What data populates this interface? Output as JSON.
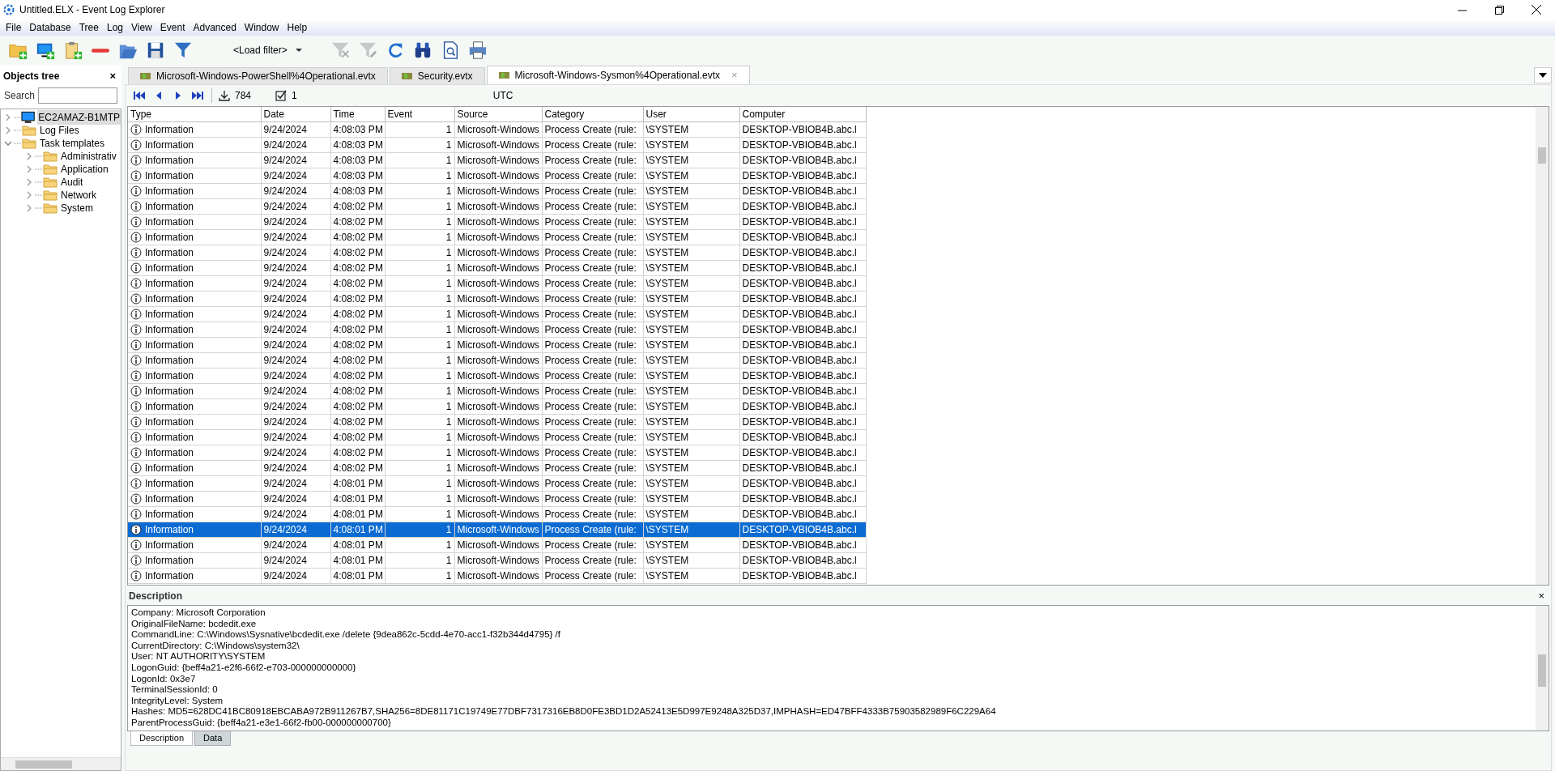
{
  "window": {
    "title": "Untitled.ELX - Event Log Explorer"
  },
  "menu": [
    "File",
    "Database",
    "Tree",
    "Log",
    "View",
    "Event",
    "Advanced",
    "Window",
    "Help"
  ],
  "toolbar": {
    "left": [
      {
        "kind": "new-folder",
        "disabled": false
      },
      {
        "kind": "computer-add",
        "disabled": false
      },
      {
        "kind": "clipboard-add",
        "disabled": false
      },
      {
        "kind": "remove",
        "disabled": false
      },
      {
        "kind": "open",
        "disabled": false
      },
      {
        "kind": "save",
        "disabled": false
      },
      {
        "kind": "filter",
        "disabled": false
      }
    ],
    "filter_combo": {
      "value": "<Load filter>"
    },
    "right": [
      {
        "kind": "filter-clear",
        "disabled": true
      },
      {
        "kind": "filter-edit",
        "disabled": true
      },
      {
        "kind": "refresh",
        "disabled": false
      },
      {
        "kind": "find",
        "disabled": false
      },
      {
        "kind": "preview",
        "disabled": false
      },
      {
        "kind": "print",
        "disabled": false
      }
    ]
  },
  "objects_tree": {
    "title": "Objects tree",
    "close": "×",
    "search_label": "Search",
    "items": [
      {
        "label": "EC2AMAZ-B1MTP",
        "kind": "computer",
        "expanded": false,
        "selected": true
      },
      {
        "label": "Log Files",
        "kind": "folder",
        "expanded": false,
        "selected": false
      },
      {
        "label": "Task templates",
        "kind": "folder",
        "expanded": true,
        "selected": false,
        "children": [
          {
            "label": "Administrativ",
            "kind": "folder",
            "expanded": false,
            "selected": false
          },
          {
            "label": "Application",
            "kind": "folder",
            "expanded": false,
            "selected": false
          },
          {
            "label": "Audit",
            "kind": "folder",
            "expanded": false,
            "selected": false
          },
          {
            "label": "Network",
            "kind": "folder",
            "expanded": false,
            "selected": false
          },
          {
            "label": "System",
            "kind": "folder",
            "expanded": false,
            "selected": false
          }
        ]
      }
    ]
  },
  "tabs": [
    {
      "label": "Microsoft-Windows-PowerShell%4Operational.evtx",
      "selected": false
    },
    {
      "label": "Security.evtx",
      "selected": false
    },
    {
      "label": "Microsoft-Windows-Sysmon%4Operational.evtx",
      "selected": true,
      "close": "×"
    }
  ],
  "navigator": {
    "count": "784",
    "checked": "1",
    "timezone": "UTC"
  },
  "table": {
    "columns": [
      "Type",
      "Date",
      "Time",
      "Event",
      "Source",
      "Category",
      "User",
      "Computer"
    ],
    "rows": [
      {
        "type": "Information",
        "date": "9/24/2024",
        "time": "4:08:03 PM",
        "event": "1",
        "source": "Microsoft-Windows",
        "category": "Process Create (rule:",
        "user": "\\SYSTEM",
        "computer": "DESKTOP-VBIOB4B.abc.l",
        "selected": false
      },
      {
        "type": "Information",
        "date": "9/24/2024",
        "time": "4:08:03 PM",
        "event": "1",
        "source": "Microsoft-Windows",
        "category": "Process Create (rule:",
        "user": "\\SYSTEM",
        "computer": "DESKTOP-VBIOB4B.abc.l",
        "selected": false
      },
      {
        "type": "Information",
        "date": "9/24/2024",
        "time": "4:08:03 PM",
        "event": "1",
        "source": "Microsoft-Windows",
        "category": "Process Create (rule:",
        "user": "\\SYSTEM",
        "computer": "DESKTOP-VBIOB4B.abc.l",
        "selected": false
      },
      {
        "type": "Information",
        "date": "9/24/2024",
        "time": "4:08:03 PM",
        "event": "1",
        "source": "Microsoft-Windows",
        "category": "Process Create (rule:",
        "user": "\\SYSTEM",
        "computer": "DESKTOP-VBIOB4B.abc.l",
        "selected": false
      },
      {
        "type": "Information",
        "date": "9/24/2024",
        "time": "4:08:03 PM",
        "event": "1",
        "source": "Microsoft-Windows",
        "category": "Process Create (rule:",
        "user": "\\SYSTEM",
        "computer": "DESKTOP-VBIOB4B.abc.l",
        "selected": false
      },
      {
        "type": "Information",
        "date": "9/24/2024",
        "time": "4:08:02 PM",
        "event": "1",
        "source": "Microsoft-Windows",
        "category": "Process Create (rule:",
        "user": "\\SYSTEM",
        "computer": "DESKTOP-VBIOB4B.abc.l",
        "selected": false
      },
      {
        "type": "Information",
        "date": "9/24/2024",
        "time": "4:08:02 PM",
        "event": "1",
        "source": "Microsoft-Windows",
        "category": "Process Create (rule:",
        "user": "\\SYSTEM",
        "computer": "DESKTOP-VBIOB4B.abc.l",
        "selected": false
      },
      {
        "type": "Information",
        "date": "9/24/2024",
        "time": "4:08:02 PM",
        "event": "1",
        "source": "Microsoft-Windows",
        "category": "Process Create (rule:",
        "user": "\\SYSTEM",
        "computer": "DESKTOP-VBIOB4B.abc.l",
        "selected": false
      },
      {
        "type": "Information",
        "date": "9/24/2024",
        "time": "4:08:02 PM",
        "event": "1",
        "source": "Microsoft-Windows",
        "category": "Process Create (rule:",
        "user": "\\SYSTEM",
        "computer": "DESKTOP-VBIOB4B.abc.l",
        "selected": false
      },
      {
        "type": "Information",
        "date": "9/24/2024",
        "time": "4:08:02 PM",
        "event": "1",
        "source": "Microsoft-Windows",
        "category": "Process Create (rule:",
        "user": "\\SYSTEM",
        "computer": "DESKTOP-VBIOB4B.abc.l",
        "selected": false
      },
      {
        "type": "Information",
        "date": "9/24/2024",
        "time": "4:08:02 PM",
        "event": "1",
        "source": "Microsoft-Windows",
        "category": "Process Create (rule:",
        "user": "\\SYSTEM",
        "computer": "DESKTOP-VBIOB4B.abc.l",
        "selected": false
      },
      {
        "type": "Information",
        "date": "9/24/2024",
        "time": "4:08:02 PM",
        "event": "1",
        "source": "Microsoft-Windows",
        "category": "Process Create (rule:",
        "user": "\\SYSTEM",
        "computer": "DESKTOP-VBIOB4B.abc.l",
        "selected": false
      },
      {
        "type": "Information",
        "date": "9/24/2024",
        "time": "4:08:02 PM",
        "event": "1",
        "source": "Microsoft-Windows",
        "category": "Process Create (rule:",
        "user": "\\SYSTEM",
        "computer": "DESKTOP-VBIOB4B.abc.l",
        "selected": false
      },
      {
        "type": "Information",
        "date": "9/24/2024",
        "time": "4:08:02 PM",
        "event": "1",
        "source": "Microsoft-Windows",
        "category": "Process Create (rule:",
        "user": "\\SYSTEM",
        "computer": "DESKTOP-VBIOB4B.abc.l",
        "selected": false
      },
      {
        "type": "Information",
        "date": "9/24/2024",
        "time": "4:08:02 PM",
        "event": "1",
        "source": "Microsoft-Windows",
        "category": "Process Create (rule:",
        "user": "\\SYSTEM",
        "computer": "DESKTOP-VBIOB4B.abc.l",
        "selected": false
      },
      {
        "type": "Information",
        "date": "9/24/2024",
        "time": "4:08:02 PM",
        "event": "1",
        "source": "Microsoft-Windows",
        "category": "Process Create (rule:",
        "user": "\\SYSTEM",
        "computer": "DESKTOP-VBIOB4B.abc.l",
        "selected": false
      },
      {
        "type": "Information",
        "date": "9/24/2024",
        "time": "4:08:02 PM",
        "event": "1",
        "source": "Microsoft-Windows",
        "category": "Process Create (rule:",
        "user": "\\SYSTEM",
        "computer": "DESKTOP-VBIOB4B.abc.l",
        "selected": false
      },
      {
        "type": "Information",
        "date": "9/24/2024",
        "time": "4:08:02 PM",
        "event": "1",
        "source": "Microsoft-Windows",
        "category": "Process Create (rule:",
        "user": "\\SYSTEM",
        "computer": "DESKTOP-VBIOB4B.abc.l",
        "selected": false
      },
      {
        "type": "Information",
        "date": "9/24/2024",
        "time": "4:08:02 PM",
        "event": "1",
        "source": "Microsoft-Windows",
        "category": "Process Create (rule:",
        "user": "\\SYSTEM",
        "computer": "DESKTOP-VBIOB4B.abc.l",
        "selected": false
      },
      {
        "type": "Information",
        "date": "9/24/2024",
        "time": "4:08:02 PM",
        "event": "1",
        "source": "Microsoft-Windows",
        "category": "Process Create (rule:",
        "user": "\\SYSTEM",
        "computer": "DESKTOP-VBIOB4B.abc.l",
        "selected": false
      },
      {
        "type": "Information",
        "date": "9/24/2024",
        "time": "4:08:02 PM",
        "event": "1",
        "source": "Microsoft-Windows",
        "category": "Process Create (rule:",
        "user": "\\SYSTEM",
        "computer": "DESKTOP-VBIOB4B.abc.l",
        "selected": false
      },
      {
        "type": "Information",
        "date": "9/24/2024",
        "time": "4:08:02 PM",
        "event": "1",
        "source": "Microsoft-Windows",
        "category": "Process Create (rule:",
        "user": "\\SYSTEM",
        "computer": "DESKTOP-VBIOB4B.abc.l",
        "selected": false
      },
      {
        "type": "Information",
        "date": "9/24/2024",
        "time": "4:08:02 PM",
        "event": "1",
        "source": "Microsoft-Windows",
        "category": "Process Create (rule:",
        "user": "\\SYSTEM",
        "computer": "DESKTOP-VBIOB4B.abc.l",
        "selected": false
      },
      {
        "type": "Information",
        "date": "9/24/2024",
        "time": "4:08:01 PM",
        "event": "1",
        "source": "Microsoft-Windows",
        "category": "Process Create (rule:",
        "user": "\\SYSTEM",
        "computer": "DESKTOP-VBIOB4B.abc.l",
        "selected": false
      },
      {
        "type": "Information",
        "date": "9/24/2024",
        "time": "4:08:01 PM",
        "event": "1",
        "source": "Microsoft-Windows",
        "category": "Process Create (rule:",
        "user": "\\SYSTEM",
        "computer": "DESKTOP-VBIOB4B.abc.l",
        "selected": false
      },
      {
        "type": "Information",
        "date": "9/24/2024",
        "time": "4:08:01 PM",
        "event": "1",
        "source": "Microsoft-Windows",
        "category": "Process Create (rule:",
        "user": "\\SYSTEM",
        "computer": "DESKTOP-VBIOB4B.abc.l",
        "selected": false
      },
      {
        "type": "Information",
        "date": "9/24/2024",
        "time": "4:08:01 PM",
        "event": "1",
        "source": "Microsoft-Windows",
        "category": "Process Create (rule:",
        "user": "\\SYSTEM",
        "computer": "DESKTOP-VBIOB4B.abc.l",
        "selected": true
      },
      {
        "type": "Information",
        "date": "9/24/2024",
        "time": "4:08:01 PM",
        "event": "1",
        "source": "Microsoft-Windows",
        "category": "Process Create (rule:",
        "user": "\\SYSTEM",
        "computer": "DESKTOP-VBIOB4B.abc.l",
        "selected": false
      },
      {
        "type": "Information",
        "date": "9/24/2024",
        "time": "4:08:01 PM",
        "event": "1",
        "source": "Microsoft-Windows",
        "category": "Process Create (rule:",
        "user": "\\SYSTEM",
        "computer": "DESKTOP-VBIOB4B.abc.l",
        "selected": false
      },
      {
        "type": "Information",
        "date": "9/24/2024",
        "time": "4:08:01 PM",
        "event": "1",
        "source": "Microsoft-Windows",
        "category": "Process Create (rule:",
        "user": "\\SYSTEM",
        "computer": "DESKTOP-VBIOB4B.abc.l",
        "selected": false
      }
    ]
  },
  "description": {
    "title": "Description",
    "close": "×",
    "lines": [
      "Company: Microsoft Corporation",
      "OriginalFileName: bcdedit.exe",
      "CommandLine: C:\\Windows\\Sysnative\\bcdedit.exe  /delete {9dea862c-5cdd-4e70-acc1-f32b344d4795} /f",
      "CurrentDirectory: C:\\Windows\\system32\\",
      "User: NT AUTHORITY\\SYSTEM",
      "LogonGuid: {beff4a21-e2f6-66f2-e703-000000000000}",
      "LogonId: 0x3e7",
      "TerminalSessionId: 0",
      "IntegrityLevel: System",
      "Hashes: MD5=628DC41BC80918EBCABA972B911267B7,SHA256=8DE81171C19749E77DBF7317316EB8D0FE3BD1D2A52413E5D997E9248A325D37,IMPHASH=ED47BFF4333B75903582989F6C229A64",
      "ParentProcessGuid: {beff4a21-e3e1-66f2-fb00-000000000700}"
    ],
    "tabs": [
      {
        "label": "Description",
        "selected": true
      },
      {
        "label": "Data",
        "selected": false
      }
    ]
  }
}
